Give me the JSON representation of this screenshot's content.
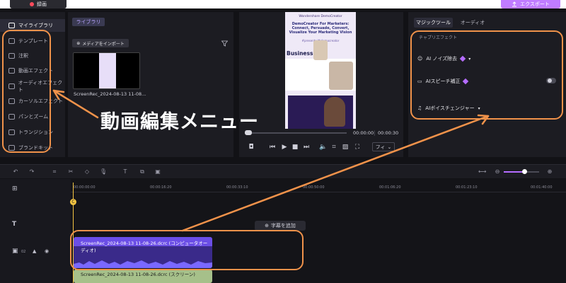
{
  "topbar": {
    "record_label": "録画",
    "export_label": "エクスポート"
  },
  "sidebar": {
    "items": [
      {
        "label": "マイライブラリ",
        "active": true
      },
      {
        "label": "テンプレート"
      },
      {
        "label": "注釈"
      },
      {
        "label": "動画エフェクト"
      },
      {
        "label": "オーディオエフェクト"
      },
      {
        "label": "カーソルエフェクト"
      },
      {
        "label": "パンとズーム"
      },
      {
        "label": "トランジション"
      },
      {
        "label": "ブランドキット"
      }
    ]
  },
  "library": {
    "tab_label": "ライブラリ",
    "import_label": "メディアをインポート",
    "media": [
      {
        "name": "ScreenRec_2024-08-13 11-08..."
      }
    ]
  },
  "preview": {
    "video": {
      "logo_text": "Wondershare DemoCreator",
      "headline": "DemoCreator For Marketers: Connect, Persuade, Convert, Visualize Your Marketing Vision",
      "hashtag": "#presentwithdemocreator",
      "plan_title": "Business Plan"
    },
    "time_current": "00:00:00",
    "time_total": "00:00:30",
    "fit_label": "フィ"
  },
  "right_panel": {
    "tabs": [
      {
        "label": "マジックツール",
        "active": true
      },
      {
        "label": "オーディオ"
      }
    ],
    "scrolled_text": "チャプリエフェクト",
    "items": [
      {
        "label": "AI ノイズ除去"
      },
      {
        "label": "AIスピーチ補正"
      },
      {
        "label": "AIボイスチェンジャー"
      }
    ]
  },
  "timeline": {
    "ruler_ticks": [
      "00:00:00:00",
      "00:00:16:20",
      "00:00:33:10",
      "00:00:50:00",
      "00:01:06:20",
      "00:01:23:10",
      "00:01:40:00"
    ],
    "playhead_label": "C",
    "add_subtitle_label": "字幕を追加",
    "track_number": "02",
    "audio_clip_name": "ScreenRec_2024-08-13 11-08-26.dcrc (コンピュータオーディオ)",
    "screen_clip_name": "ScreenRec_2024-08-13 11-08-26.dcrc (スクリーン)"
  },
  "annotation": {
    "text": "動画編集メニュー",
    "color": "#f0924a"
  }
}
